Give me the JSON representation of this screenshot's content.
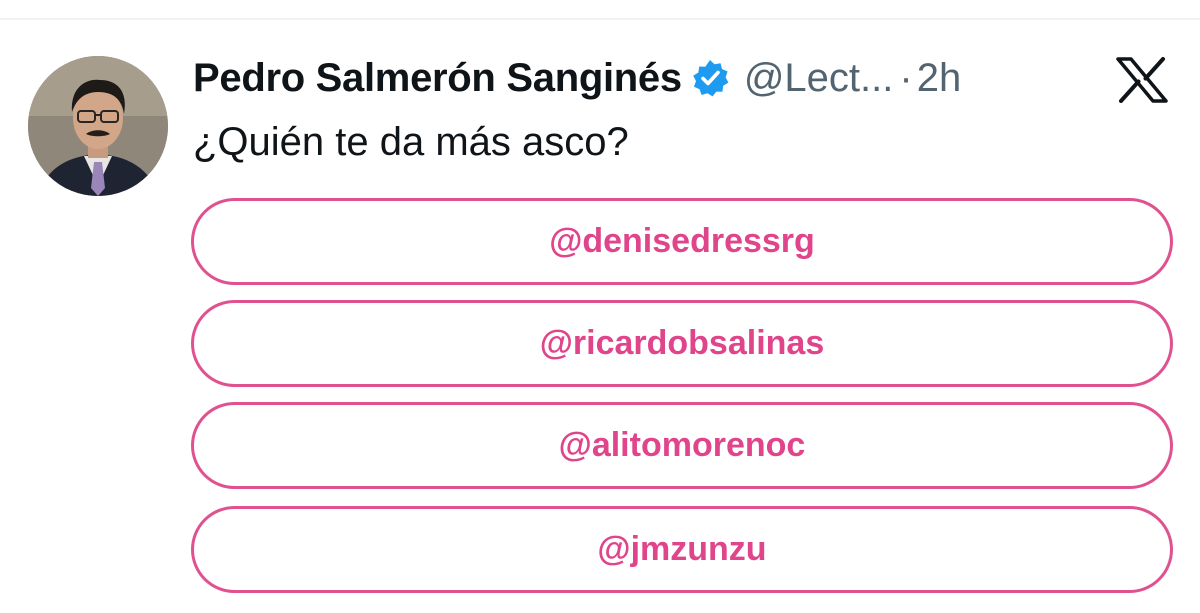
{
  "tweet": {
    "author": {
      "display_name": "Pedro Salmerón Sanginés",
      "handle": "@Lect...",
      "verified": true,
      "avatar_icon": "user-photo-avatar"
    },
    "separator": "·",
    "time": "2h",
    "platform_icon": "x-logo-icon",
    "text": "¿Quién te da más asco?",
    "poll": {
      "accent_color": "#e0528f",
      "options": [
        {
          "label": "@denisedressrg"
        },
        {
          "label": "@ricardobsalinas"
        },
        {
          "label": "@alitomorenoc"
        },
        {
          "label": "@jmzunzu"
        }
      ]
    }
  },
  "colors": {
    "text_primary": "#0f1419",
    "text_secondary": "#536471",
    "verified_blue": "#1d9bf0",
    "poll_pink": "#e0448b"
  }
}
